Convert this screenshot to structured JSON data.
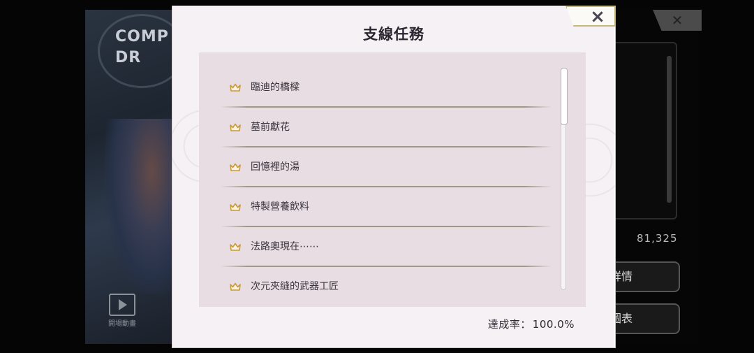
{
  "background": {
    "logo_text": [
      "COMP",
      "DR"
    ],
    "movie_label": "開場動畫",
    "number": "81,325",
    "buttons": [
      "詳情",
      "圖表"
    ]
  },
  "dialog": {
    "title": "支線任務",
    "close_label": "×",
    "items": [
      {
        "label": "臨迪的橋樑",
        "icon": "crown-icon"
      },
      {
        "label": "墓前獻花",
        "icon": "crown-icon"
      },
      {
        "label": "回憶裡的湯",
        "icon": "crown-icon"
      },
      {
        "label": "特製營養飲料",
        "icon": "crown-icon"
      },
      {
        "label": "法路奧現在⋯⋯",
        "icon": "crown-icon"
      },
      {
        "label": "次元夾縫的武器工匠",
        "icon": "crown-icon"
      }
    ],
    "completion_label": "達成率：",
    "completion_value": "100.0%"
  },
  "colors": {
    "dialog_bg": "#f5f1f4",
    "list_bg": "#e7dde3",
    "crown": "#c89a3a",
    "close_border": "#c8b77a"
  }
}
